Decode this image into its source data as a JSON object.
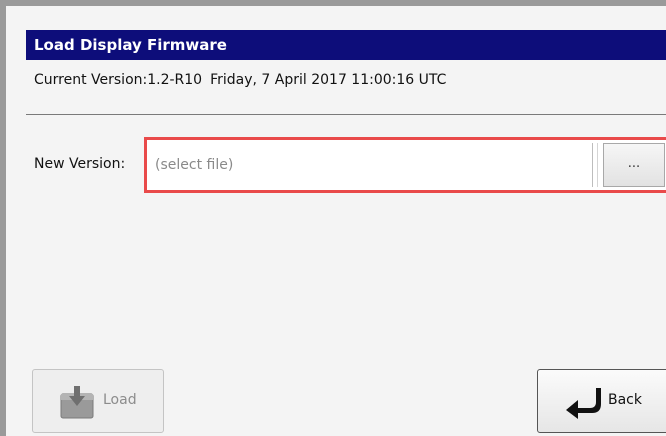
{
  "dialog": {
    "title": "Load Display Firmware",
    "current_version": "Current Version:1.2-R10",
    "current_date": "Friday, 7 April 2017 11:00:16 UTC"
  },
  "new_version": {
    "label": "New Version:",
    "placeholder": "(select file)",
    "browse_label": "...",
    "highlight_color": "#e94a4a"
  },
  "actions": {
    "load_label": "Load",
    "load_icon": "download-box-icon",
    "back_label": "Back",
    "back_icon": "return-arrow-icon"
  },
  "colors": {
    "title_bar": "#0d0d7a",
    "title_text": "#ffffff"
  }
}
